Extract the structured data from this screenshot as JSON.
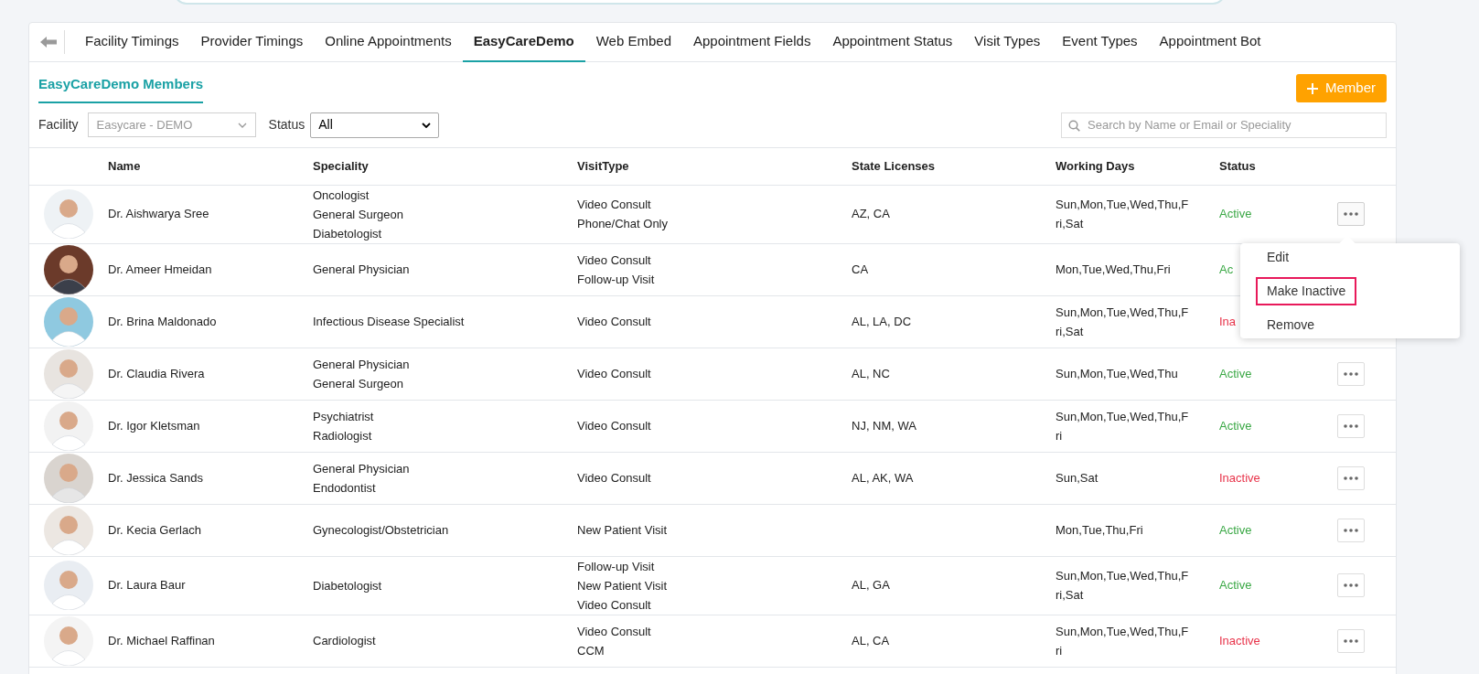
{
  "tabs": [
    {
      "label": "Facility Timings",
      "selected": false
    },
    {
      "label": "Provider Timings",
      "selected": false
    },
    {
      "label": "Online Appointments",
      "selected": false
    },
    {
      "label": "EasyCareDemo",
      "selected": true
    },
    {
      "label": "Web Embed",
      "selected": false
    },
    {
      "label": "Appointment Fields",
      "selected": false
    },
    {
      "label": "Appointment Status",
      "selected": false
    },
    {
      "label": "Visit Types",
      "selected": false
    },
    {
      "label": "Event Types",
      "selected": false
    },
    {
      "label": "Appointment Bot",
      "selected": false
    }
  ],
  "subtab": {
    "label": "EasyCareDemo Members",
    "selected": true
  },
  "add_button": {
    "label": "Member"
  },
  "filters": {
    "facility_label": "Facility",
    "facility_value": "Easycare - DEMO",
    "status_label": "Status",
    "status_value": "All"
  },
  "search": {
    "placeholder": "Search by Name or Email or Speciality"
  },
  "table": {
    "columns": [
      "Name",
      "Speciality",
      "VisitType",
      "State Licenses",
      "Working Days",
      "Status"
    ],
    "rows": [
      {
        "name": "Dr. Aishwarya Sree",
        "speciality": [
          "Oncologist",
          "General Surgeon",
          "Diabetologist"
        ],
        "visit_types": [
          "Video Consult",
          "Phone/Chat Only"
        ],
        "licenses": "AZ, CA",
        "working_days": [
          "Sun,Mon,Tue,Wed,Thu,F",
          "ri,Sat"
        ],
        "status": "Active",
        "active": true,
        "menu_open": true
      },
      {
        "name": "Dr. Ameer Hmeidan",
        "speciality": [
          "General Physician"
        ],
        "visit_types": [
          "Video Consult",
          "Follow-up Visit"
        ],
        "licenses": "CA",
        "working_days": [
          "Mon,Tue,Wed,Thu,Fri"
        ],
        "status": "Ac",
        "active": true
      },
      {
        "name": "Dr. Brina Maldonado",
        "speciality": [
          "Infectious Disease Specialist"
        ],
        "visit_types": [
          "Video Consult"
        ],
        "licenses": "AL, LA, DC",
        "working_days": [
          "Sun,Mon,Tue,Wed,Thu,F",
          "ri,Sat"
        ],
        "status": "Ina",
        "active": false
      },
      {
        "name": "Dr. Claudia Rivera",
        "speciality": [
          "General Physician",
          "General Surgeon"
        ],
        "visit_types": [
          "Video Consult"
        ],
        "licenses": "AL, NC",
        "working_days": [
          "Sun,Mon,Tue,Wed,Thu"
        ],
        "status": "Active",
        "active": true
      },
      {
        "name": "Dr. Igor Kletsman",
        "speciality": [
          "Psychiatrist",
          "Radiologist"
        ],
        "visit_types": [
          "Video Consult"
        ],
        "licenses": "NJ, NM, WA",
        "working_days": [
          "Sun,Mon,Tue,Wed,Thu,F",
          "ri"
        ],
        "status": "Active",
        "active": true
      },
      {
        "name": "Dr. Jessica Sands",
        "speciality": [
          "General Physician",
          "Endodontist"
        ],
        "visit_types": [
          "Video Consult"
        ],
        "licenses": "AL, AK, WA",
        "working_days": [
          "Sun,Sat"
        ],
        "status": "Inactive",
        "active": false
      },
      {
        "name": "Dr. Kecia Gerlach",
        "speciality": [
          "Gynecologist/Obstetrician"
        ],
        "visit_types": [
          "New Patient Visit"
        ],
        "working_days": [
          "Mon,Tue,Thu,Fri"
        ],
        "status": "Active",
        "active": true
      },
      {
        "name": "Dr. Laura Baur",
        "speciality": [
          "Diabetologist"
        ],
        "visit_types": [
          "Follow-up Visit",
          "New Patient Visit",
          "Video Consult"
        ],
        "licenses": "AL, GA",
        "working_days": [
          "Sun,Mon,Tue,Wed,Thu,F",
          "ri,Sat"
        ],
        "status": "Active",
        "active": true
      },
      {
        "name": "Dr. Michael Raffinan",
        "speciality": [
          "Cardiologist"
        ],
        "visit_types": [
          "Video Consult",
          "CCM"
        ],
        "licenses": "AL, CA",
        "working_days": [
          "Sun,Mon,Tue,Wed,Thu,F",
          "ri"
        ],
        "status": "Inactive",
        "active": false
      }
    ]
  },
  "menu": {
    "items": [
      {
        "label": "Edit",
        "highlighted": false
      },
      {
        "label": "Make Inactive",
        "highlighted": true
      },
      {
        "label": "Remove",
        "highlighted": false
      }
    ]
  }
}
